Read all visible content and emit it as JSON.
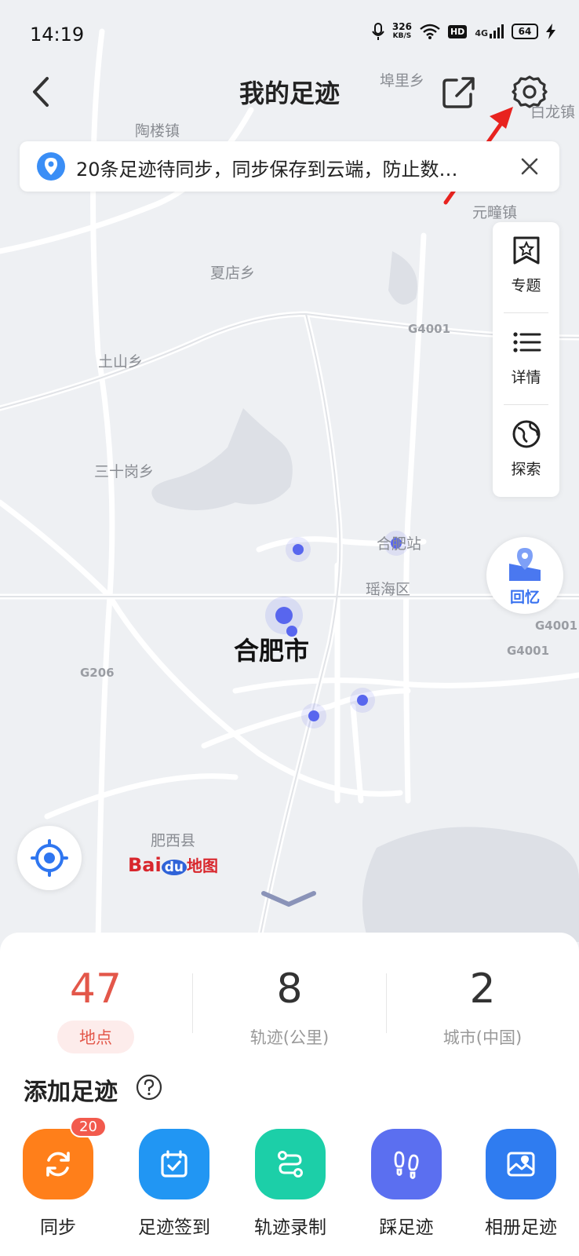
{
  "status_bar": {
    "time": "14:19",
    "speed_value": "326",
    "speed_unit": "KB/S",
    "hd": "HD",
    "network": "4G",
    "battery": "64"
  },
  "header": {
    "title": "我的足迹"
  },
  "notice": {
    "text": "20条足迹待同步，同步保存到云端，防止数…"
  },
  "side_panel": {
    "items": [
      {
        "label": "专题",
        "icon": "star-frame-icon"
      },
      {
        "label": "详情",
        "icon": "list-icon"
      },
      {
        "label": "探索",
        "icon": "globe-icon"
      }
    ]
  },
  "memory_button": {
    "label": "回忆"
  },
  "map": {
    "places": [
      "埠里乡",
      "陶楼镇",
      "白龙镇",
      "元疃镇",
      "夏店乡",
      "土山乡",
      "三十岗乡",
      "合肥站",
      "瑶海区",
      "肥西县"
    ],
    "roads": [
      "G4001",
      "G4001",
      "G4001",
      "G206"
    ],
    "city": "合肥市",
    "logo": {
      "bai": "Bai",
      "du": "du",
      "ditu": "地图"
    }
  },
  "stats": [
    {
      "value": "47",
      "label": "地点"
    },
    {
      "value": "8",
      "label": "轨迹(公里)"
    },
    {
      "value": "2",
      "label": "城市(中国)"
    }
  ],
  "add_section": {
    "title": "添加足迹"
  },
  "actions": [
    {
      "label": "同步",
      "badge": "20",
      "color": "#ff7f1a"
    },
    {
      "label": "足迹签到",
      "color": "#2196f3"
    },
    {
      "label": "轨迹录制",
      "color": "#1ccfa8"
    },
    {
      "label": "踩足迹",
      "color": "#5b6ff0"
    },
    {
      "label": "相册足迹",
      "color": "#2f7cf0"
    }
  ],
  "colors": {
    "accent": "#e3574a",
    "map_bg": "#eef0f3",
    "pin": "#5866ee",
    "annotation_arrow": "#e8231f"
  }
}
